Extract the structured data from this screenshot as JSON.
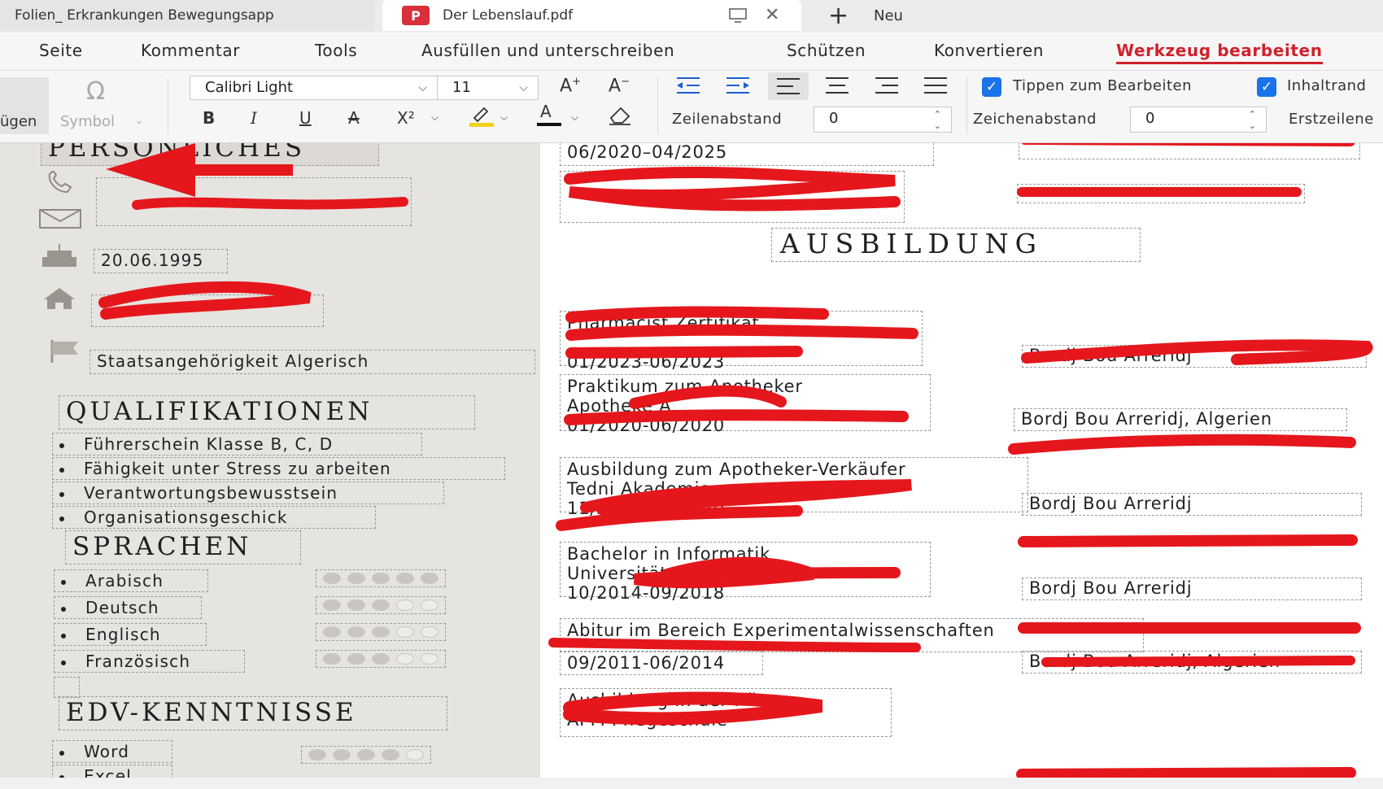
{
  "tabs": [
    {
      "label": "Folien_ Erkrankungen Bewegungsapp"
    },
    {
      "label": "Der Lebenslauf.pdf",
      "badge": "P"
    }
  ],
  "new_tab_label": "Neu",
  "menu": [
    "Seite",
    "Kommentar",
    "Tools",
    "Ausfüllen und unterschreiben",
    "Schützen",
    "Konvertieren",
    "Werkzeug bearbeiten"
  ],
  "toolbar": {
    "left_label": "ügen",
    "symbol_label": "Symbol",
    "font_family": "Calibri Light",
    "font_size": "11",
    "line_spacing_label": "Zeilenabstand",
    "line_spacing_value": "0",
    "char_spacing_label": "Zeichenabstand",
    "char_spacing_value": "0",
    "first_line_label": "Erstzeilene",
    "tap_to_edit_label": "Tippen zum Bearbeiten",
    "content_border_label": "Inhaltrand",
    "bold": "B",
    "italic": "I",
    "underline": "U",
    "strike": "A",
    "superscript": "X²",
    "font_color": "A"
  },
  "sidebar": {
    "personal_heading": "PERSÖNLICHES",
    "birth_date": "20.06.1995",
    "nationality": "Staatsangehörigkeit Algerisch",
    "qualifications_heading": "QUALIFIKATIONEN",
    "qualifications": [
      "Führerschein Klasse B, C, D",
      "Fähigkeit unter Stress zu arbeiten",
      "Verantwortungsbewusstsein",
      "Organisationsgeschick"
    ],
    "languages_heading": "SPRACHEN",
    "languages": [
      {
        "name": "Arabisch",
        "level": 5
      },
      {
        "name": "Deutsch",
        "level": 3
      },
      {
        "name": "Englisch",
        "level": 3
      },
      {
        "name": "Französisch",
        "level": 3
      }
    ],
    "it_heading": "EDV-KENNTNISSE",
    "it_skills": [
      {
        "name": "Word",
        "level": 4
      },
      {
        "name": "Excel",
        "level": 0
      }
    ]
  },
  "main": {
    "top_date": "06/2020–04/2025",
    "education_heading": "AUSBILDUNG",
    "entries": [
      {
        "line1": "Pharmacist Zertifikat",
        "line2": "",
        "date": "01/2023-06/2023",
        "place": "Bordj Bou Arreridj"
      },
      {
        "line1": "Praktikum zum Apotheker",
        "line2": "Apotheke A",
        "date": "01/2020-06/2020",
        "place": "Bordj Bou Arreridj, Algerien"
      },
      {
        "line1": "Ausbildung zum Apotheker-Verkäufer",
        "line2": "Tedni Akademie",
        "date": "11/2019-01/2020",
        "place": "Bordj Bou Arreridj"
      },
      {
        "line1": "Bachelor in Informatik",
        "line2": "Universität",
        "date": "10/2014-09/2018",
        "place": "Bordj Bou Arreridj"
      },
      {
        "line1": "Abitur im Bereich Experimentalwissenschaften",
        "line2": "",
        "date": "09/2011-06/2014",
        "place": "Bordj Bou Arreridj, Algerien"
      },
      {
        "line1": "Ausbildung in der Pflege",
        "line2": "APM Pflegeschule",
        "date": "",
        "place": ""
      }
    ]
  },
  "colors": {
    "accent": "#d0212d",
    "redaction": "#e5171c",
    "checkbox": "#1a73e8"
  }
}
